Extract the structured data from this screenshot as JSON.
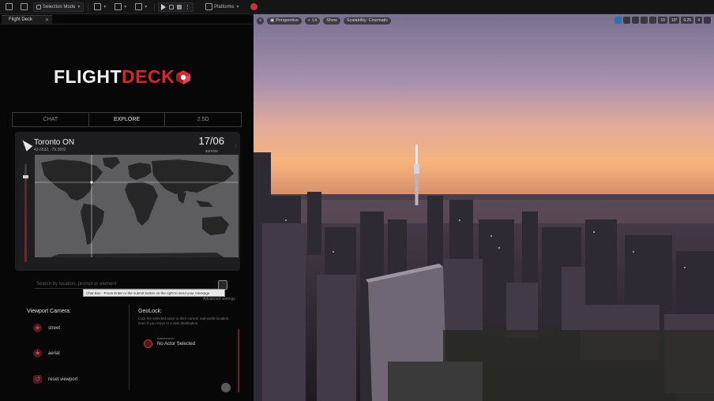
{
  "toolbar": {
    "selection_mode": "Selection Mode",
    "platforms": "Platforms"
  },
  "panel": {
    "tab_label": "Flight Deck",
    "logo_white": "FLIGHT",
    "logo_red": "DECK",
    "modes": [
      "CHAT",
      "EXPLORE",
      "2.5D"
    ],
    "active_mode": "EXPLORE"
  },
  "location": {
    "city": "Toronto ON",
    "coords": "43.6532, -79.3832",
    "date": "17/06",
    "time_label": "sunrise"
  },
  "search": {
    "placeholder": "Search by location, prompt or element",
    "tooltip": "Chat Box - Press Enter or the submit button on the right to send your message",
    "settings": "Advanced settings"
  },
  "camera": {
    "title": "Viewport Camera:",
    "options": [
      "street",
      "aerial",
      "reset viewport"
    ]
  },
  "geolock": {
    "title": "GeoLock:",
    "description": "Lock the selected actor to their current real-world location, even if you move to a new destination.",
    "small_label": "selected actor",
    "actor_label": "No Actor Selected"
  },
  "viewport": {
    "pills": [
      "Perspective",
      "Lit",
      "Show",
      "Scalability: Cinematic"
    ],
    "right_values": [
      "10",
      "10°",
      "0.25",
      "4"
    ]
  },
  "colors": {
    "brand_red": "#d4262f",
    "sky_top": "#7a6f95",
    "sky_horizon": "#f6b47c"
  }
}
